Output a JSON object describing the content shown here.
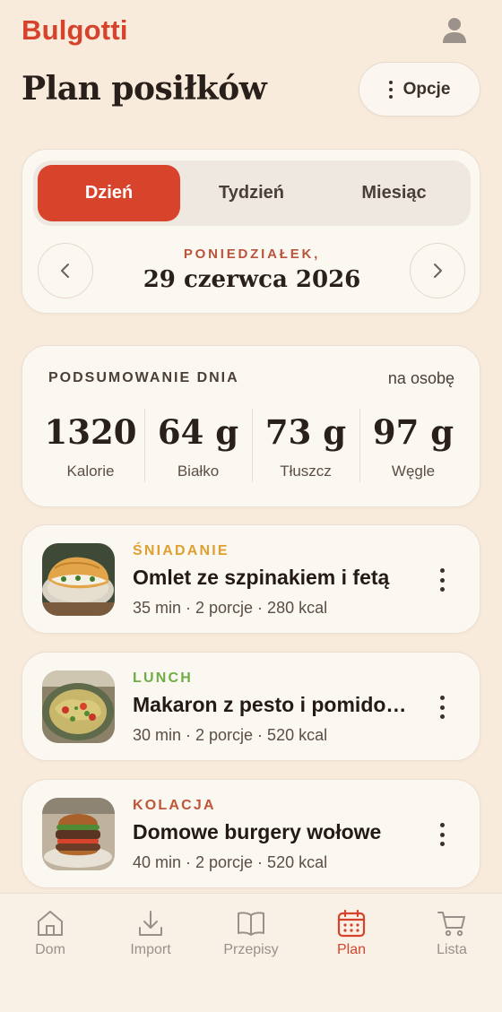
{
  "app": {
    "brand": "Bulgotti"
  },
  "header": {
    "title": "Plan posiłków",
    "options_label": "Opcje"
  },
  "date_selector": {
    "tabs": [
      {
        "label": "Dzień",
        "active": true
      },
      {
        "label": "Tydzień",
        "active": false
      },
      {
        "label": "Miesiąc",
        "active": false
      }
    ],
    "weekday": "PONIEDZIAŁEK,",
    "date": "29 czerwca 2026"
  },
  "summary": {
    "title": "PODSUMOWANIE DNIA",
    "per": "na osobę",
    "stats": [
      {
        "value": "1320",
        "label": "Kalorie"
      },
      {
        "value": "64 g",
        "label": "Białko"
      },
      {
        "value": "73 g",
        "label": "Tłuszcz"
      },
      {
        "value": "97 g",
        "label": "Węgle"
      }
    ]
  },
  "meals": [
    {
      "type": "ŚNIADANIE",
      "type_color": "#e0a030",
      "name": "Omlet ze szpinakiem i fetą",
      "meta": "35 min · 2 porcje · 280 kcal",
      "icon": "omelette-photo"
    },
    {
      "type": "LUNCH",
      "type_color": "#6fae45",
      "name": "Makaron z pesto i pomidorami",
      "meta": "30 min · 2 porcje · 520 kcal",
      "icon": "pasta-photo"
    },
    {
      "type": "KOLACJA",
      "type_color": "#c0553a",
      "name": "Domowe burgery wołowe",
      "meta": "40 min · 2 porcje · 520 kcal",
      "icon": "burger-photo"
    }
  ],
  "tabbar": {
    "items": [
      {
        "label": "Dom",
        "icon": "home-icon",
        "active": false
      },
      {
        "label": "Import",
        "icon": "download-icon",
        "active": false
      },
      {
        "label": "Przepisy",
        "icon": "book-icon",
        "active": false
      },
      {
        "label": "Plan",
        "icon": "calendar-icon",
        "active": true
      },
      {
        "label": "Lista",
        "icon": "cart-icon",
        "active": false
      }
    ]
  },
  "colors": {
    "accent": "#d6432c",
    "background": "#f9ebdb",
    "card": "#fbf7f1"
  }
}
